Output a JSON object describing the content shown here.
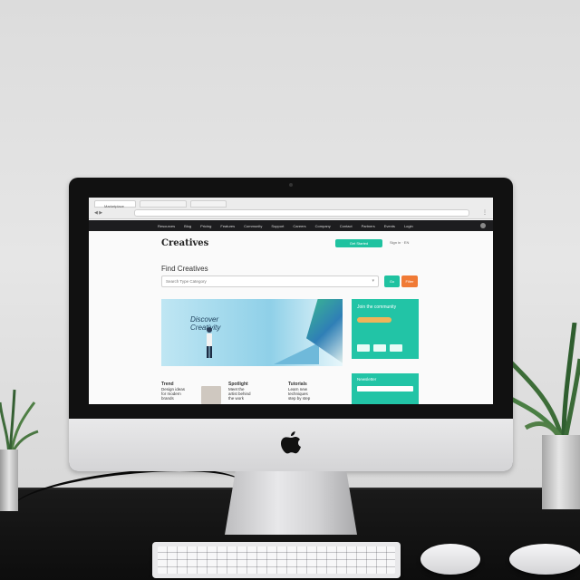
{
  "browser": {
    "tabs": [
      "Marketplace",
      "",
      ""
    ],
    "menu_icon": "menu-icon"
  },
  "site": {
    "nav_items": [
      "Resources",
      "Blog",
      "Pricing",
      "Features",
      "Community",
      "Support",
      "Careers",
      "Company",
      "Contact",
      "Partners",
      "Events",
      "Login"
    ],
    "logo": "Creatives",
    "cta_label": "Get Started",
    "top_links": "Sign in  ·  EN",
    "search_heading": "Find Creatives",
    "search_placeholder": "Search   Type   Category",
    "search_button": "Go",
    "filter_button": "Filter",
    "hero_text": "Discover Creativity",
    "side_card_title": "Join the community",
    "side_card_2_title": "Newsletter",
    "articles": [
      {
        "title": "Trend",
        "lines": [
          "Design ideas",
          "for modern",
          "brands"
        ]
      },
      {
        "title": "Spotlight",
        "lines": [
          "Meet the",
          "artist behind",
          "the work"
        ]
      },
      {
        "title": "Tutorials",
        "lines": [
          "Learn new",
          "techniques",
          "step by step"
        ]
      }
    ]
  },
  "colors": {
    "accent_teal": "#1fc2a0",
    "accent_orange": "#f07a35",
    "nav_dark": "#1d1d1f"
  }
}
